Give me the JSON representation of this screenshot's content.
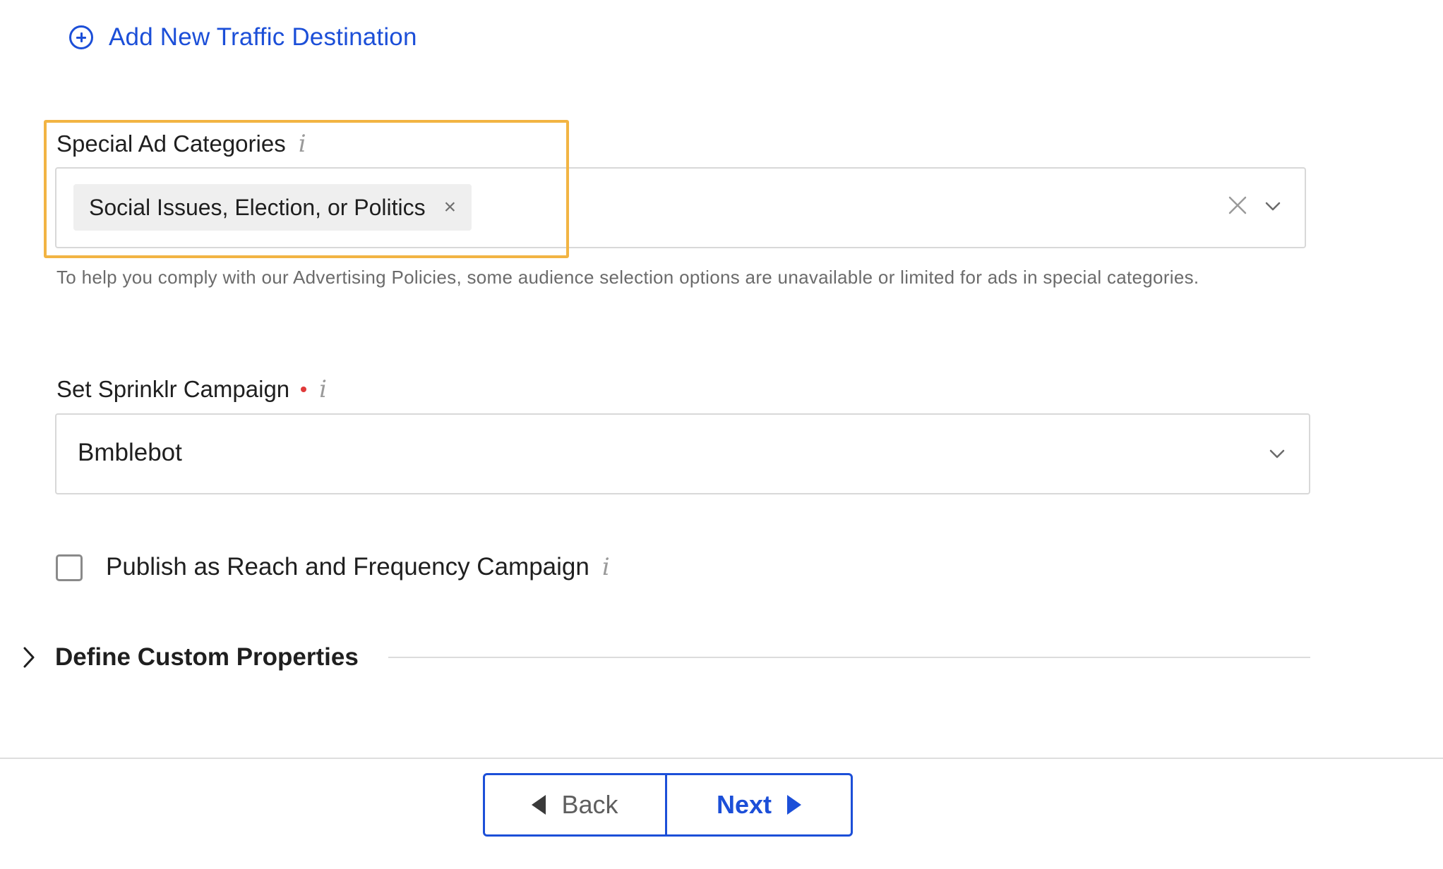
{
  "add_destination": {
    "label": "Add New Traffic Destination",
    "icon": "plus-circle-icon"
  },
  "special_ad_categories": {
    "label": "Special Ad Categories",
    "info": "i",
    "selected_chips": [
      "Social Issues, Election, or Politics"
    ],
    "chip_remove": "×",
    "help_text": "To help you comply with our Advertising Policies, some audience selection options are unavailable or limited for ads in special categories."
  },
  "campaign": {
    "label": "Set Sprinklr Campaign",
    "info": "i",
    "required": true,
    "value": "Bmblebot"
  },
  "reach_frequency": {
    "label": "Publish as Reach and Frequency Campaign",
    "info": "i",
    "checked": false
  },
  "custom_properties": {
    "title": "Define Custom Properties",
    "expanded": false
  },
  "footer": {
    "back_label": "Back",
    "next_label": "Next"
  },
  "colors": {
    "accent": "#1c4fd8",
    "highlight": "#f2b443",
    "required": "#e03a3a"
  }
}
